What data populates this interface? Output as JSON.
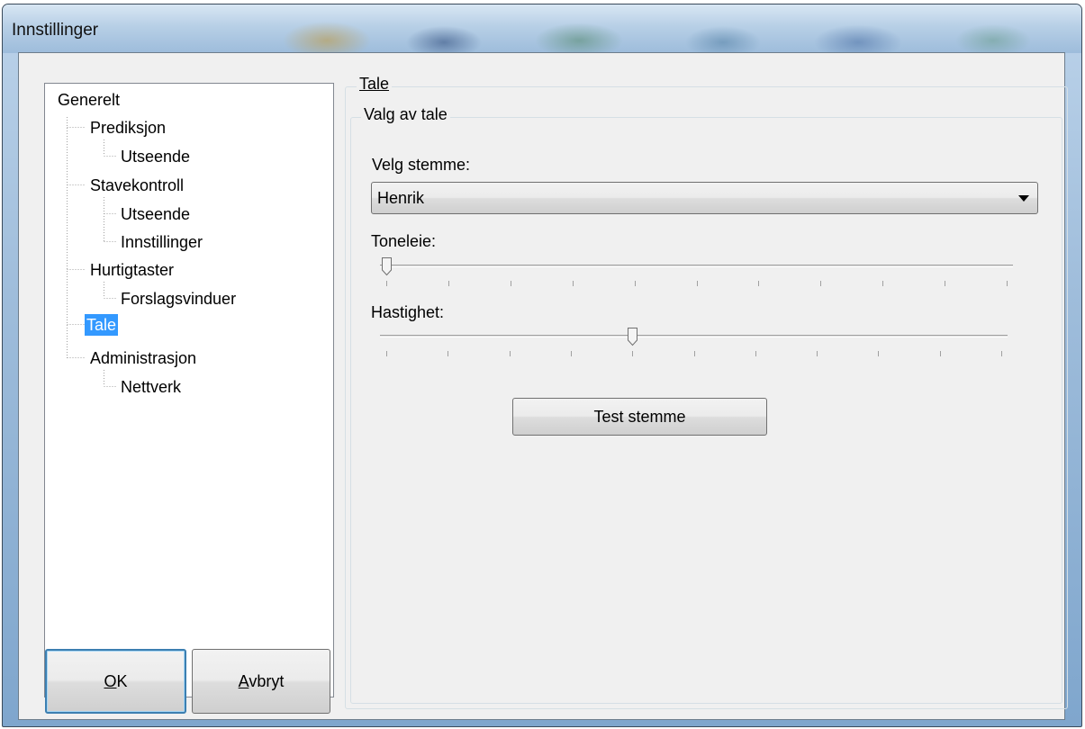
{
  "window": {
    "title": "Innstillinger"
  },
  "tree": {
    "nodes": [
      {
        "label": "Generelt"
      },
      {
        "label": "Prediksjon"
      },
      {
        "label": "Utseende"
      },
      {
        "label": "Stavekontroll"
      },
      {
        "label": "Utseende"
      },
      {
        "label": "Innstillinger"
      },
      {
        "label": "Hurtigtaster"
      },
      {
        "label": "Forslagsvinduer"
      },
      {
        "label": "Tale",
        "selected": true
      },
      {
        "label": "Administrasjon"
      },
      {
        "label": "Nettverk"
      }
    ]
  },
  "buttons": {
    "ok": {
      "mnemonic": "O",
      "rest": "K"
    },
    "cancel": {
      "mnemonic": "A",
      "rest": "vbryt"
    }
  },
  "panel": {
    "title": "Tale",
    "group_title": "Valg av tale",
    "voice_label": "Velg stemme:",
    "voice_value": "Henrik",
    "pitch_label": "Toneleie:",
    "pitch_value": 0.0,
    "speed_label": "Hastighet:",
    "speed_value": 0.4,
    "test_button": "Test stemme"
  },
  "colors": {
    "selection": "#3399ff",
    "default_button_border": "#3c7fb1"
  },
  "icons": {
    "dropdown": "chevron-down-icon",
    "slider_thumb": "slider-thumb"
  }
}
